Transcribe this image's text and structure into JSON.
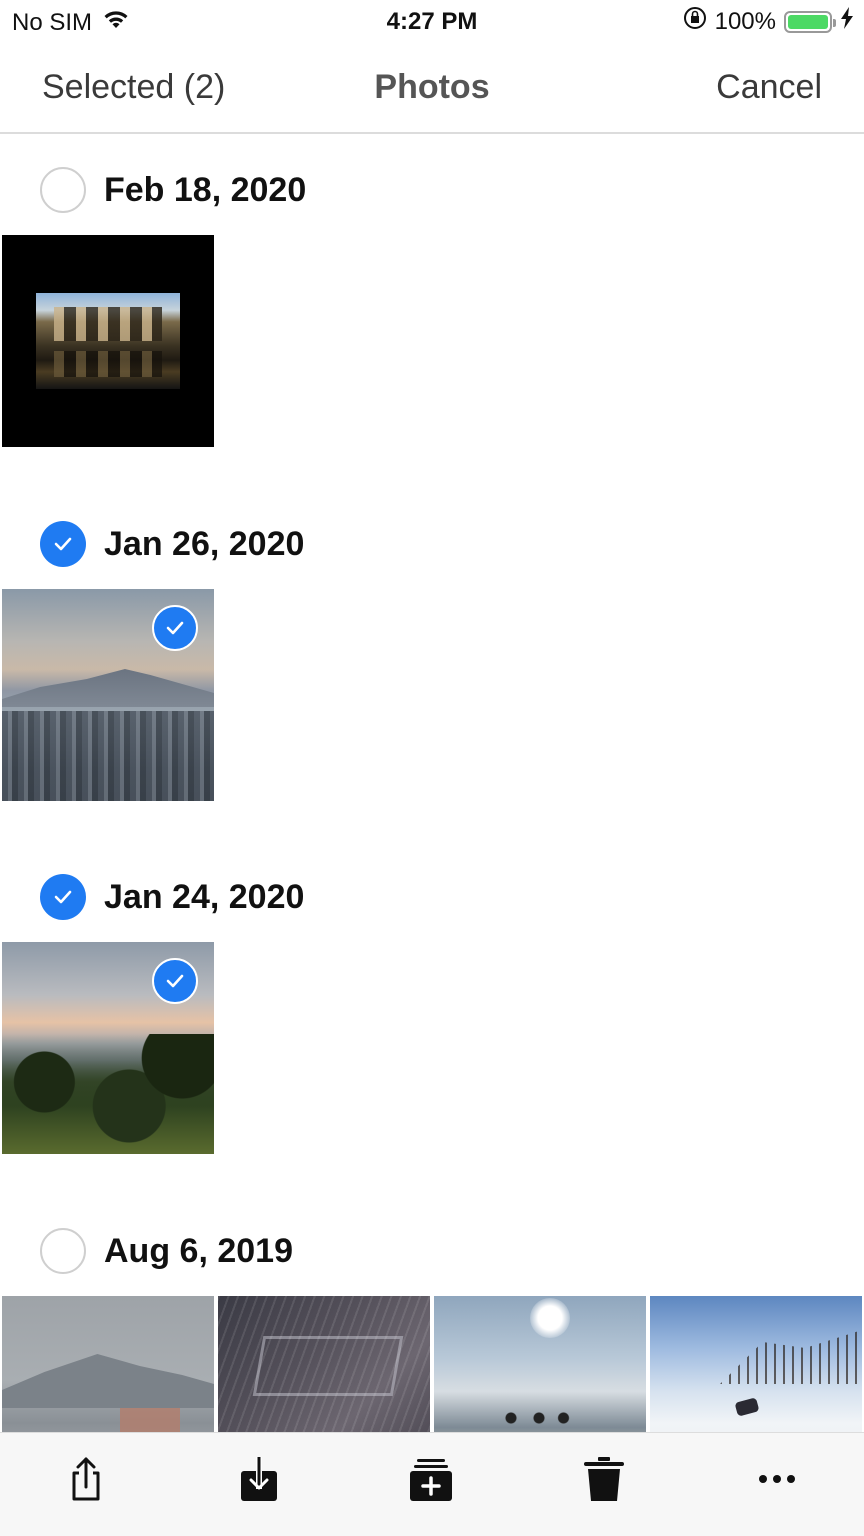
{
  "status_bar": {
    "carrier": "No SIM",
    "time": "4:27 PM",
    "battery": "100%",
    "battery_level": 1.0,
    "battery_color": "#4cd964"
  },
  "nav": {
    "left": "Selected (2)",
    "title": "Photos",
    "right": "Cancel"
  },
  "accent_color": "#1f7bf2",
  "sections": [
    {
      "date": "Feb 18, 2020",
      "selected": false,
      "photos": [
        {
          "icon": "photo-architecture",
          "selected": false
        }
      ]
    },
    {
      "date": "Jan 26, 2020",
      "selected": true,
      "photos": [
        {
          "icon": "photo-city",
          "selected": true
        }
      ]
    },
    {
      "date": "Jan 24, 2020",
      "selected": true,
      "photos": [
        {
          "icon": "photo-forest",
          "selected": true
        }
      ]
    },
    {
      "date": "Aug 6, 2019",
      "selected": false,
      "photos": [
        {
          "icon": "photo-hazy",
          "selected": false
        },
        {
          "icon": "photo-rain",
          "selected": false
        },
        {
          "icon": "photo-beach",
          "selected": false
        },
        {
          "icon": "photo-snow",
          "selected": false
        }
      ]
    }
  ],
  "toolbar": [
    {
      "icon": "share-icon"
    },
    {
      "icon": "download-icon"
    },
    {
      "icon": "add-to-album-icon"
    },
    {
      "icon": "trash-icon"
    },
    {
      "icon": "more-icon"
    }
  ]
}
